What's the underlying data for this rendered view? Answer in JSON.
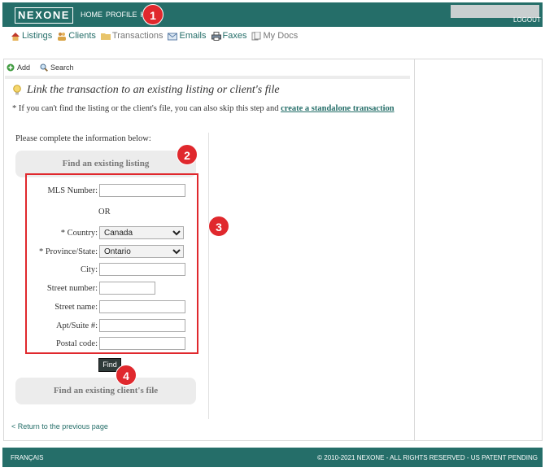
{
  "header": {
    "logo": "NEXONE",
    "nav": [
      "HOME",
      "PROFILE",
      "H"
    ],
    "logout": "LOGOUT"
  },
  "menu": {
    "items": [
      {
        "label": "Listings",
        "icon": "house-icon"
      },
      {
        "label": "Clients",
        "icon": "people-icon"
      },
      {
        "label": "Transactions",
        "icon": "folder-icon"
      },
      {
        "label": "Emails",
        "icon": "envelope-icon"
      },
      {
        "label": "Faxes",
        "icon": "printer-icon"
      },
      {
        "label": "My Docs",
        "icon": "documents-icon"
      }
    ]
  },
  "toolbar": {
    "add_label": "Add",
    "search_label": "Search"
  },
  "main": {
    "heading": "Link the transaction to an existing listing or client's file",
    "note_prefix": "* If you can't find the listing or the client's file, you can also skip this step and",
    "note_link": "create a standalone transaction",
    "complete_label": "Please complete the information below:",
    "find_listing_label": "Find an existing listing",
    "find_client_label": "Find an existing client's file",
    "back_label": "< Return to the previous page"
  },
  "form": {
    "mls_label": "MLS Number:",
    "mls_value": "",
    "or_label": "OR",
    "country_label": "* Country:",
    "country_value": "Canada",
    "province_label": "* Province/State:",
    "province_value": "Ontario",
    "city_label": "City:",
    "city_value": "",
    "street_number_label": "Street number:",
    "street_number_value": "",
    "street_name_label": "Street name:",
    "street_name_value": "",
    "apt_label": "Apt/Suite #:",
    "apt_value": "",
    "postal_label": "Postal code:",
    "postal_value": "",
    "find_button": "Find"
  },
  "footer": {
    "language": "FRANÇAIS",
    "copyright": "© 2010-2021 NEXONE - ALL RIGHTS RESERVED - US PATENT PENDING"
  },
  "callouts": [
    "1",
    "2",
    "3",
    "4"
  ],
  "colors": {
    "brand": "#256e69",
    "callout": "#e0282d",
    "section_bg": "#ececec"
  }
}
